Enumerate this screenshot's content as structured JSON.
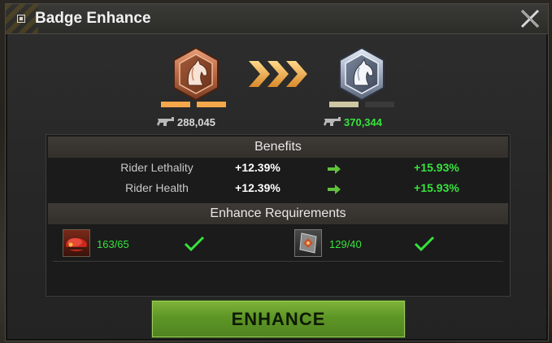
{
  "window": {
    "title": "Badge Enhance",
    "close_icon": "close-x-icon"
  },
  "current_badge": {
    "icon": "horse-head-bronze-badge-icon",
    "tier_color": "#c97a52",
    "level_segments": 2,
    "filled_segments": 2,
    "power": "288,045"
  },
  "next_badge": {
    "icon": "horse-head-silver-badge-icon",
    "tier_color": "#9aa6b8",
    "level_segments": 2,
    "filled_segments": 1,
    "power": "370,344"
  },
  "benefits": {
    "header": "Benefits",
    "rows": [
      {
        "name": "Rider Lethality",
        "current": "+12.39%",
        "next": "+15.93%"
      },
      {
        "name": "Rider Health",
        "current": "+12.39%",
        "next": "+15.93%"
      }
    ]
  },
  "requirements": {
    "header": "Enhance Requirements",
    "items": [
      {
        "icon": "red-beret-icon",
        "count": "163/65",
        "met": true
      },
      {
        "icon": "badge-material-icon",
        "count": "129/40",
        "met": true
      }
    ]
  },
  "enhance_button": {
    "label": "ENHANCE"
  },
  "colors": {
    "accent_green": "#37e33d",
    "level_orange": "#f5a84a",
    "level_cream": "#cfc6a4",
    "level_empty": "#3a3a3a"
  }
}
